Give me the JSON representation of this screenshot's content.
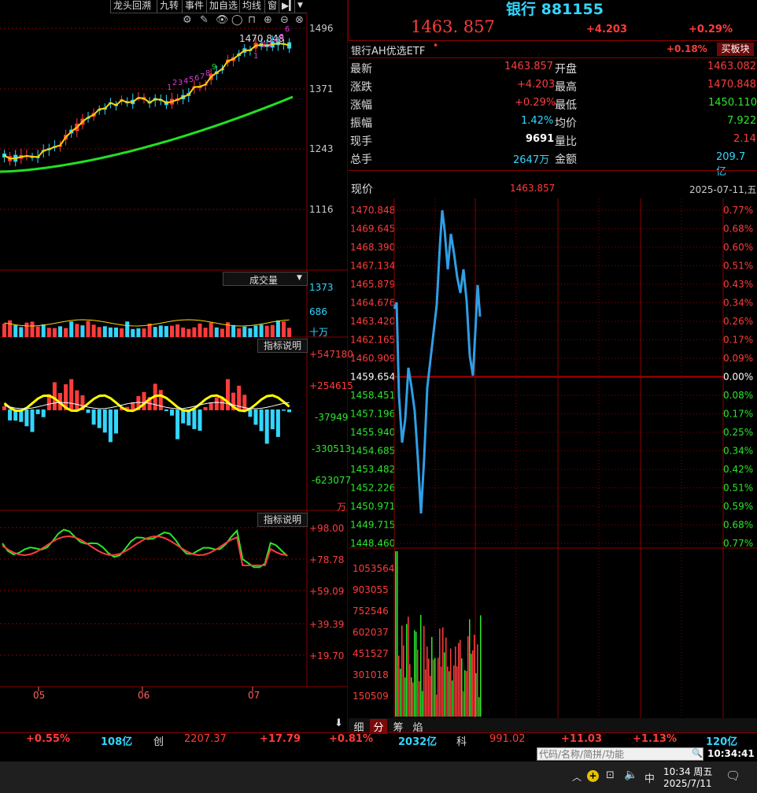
{
  "toolbar": {
    "buttons": [
      "龙头回溯",
      "九转",
      "事件",
      "加自选",
      "均线",
      "窗"
    ]
  },
  "kline": {
    "price_axis": [
      "1496",
      "1371",
      "1243",
      "1116"
    ],
    "high_label": "1470.848",
    "td_seq_low": [
      "1",
      "2",
      "3",
      "4",
      "5",
      "6",
      "7",
      "8",
      "9"
    ],
    "td_seq_recent": [
      "1",
      "2",
      "3",
      "4",
      "5",
      "6"
    ],
    "volume_title": "成交量",
    "volume_axis": [
      "1373",
      "686",
      "十万"
    ],
    "indicator_button": "指标说明",
    "macd_axis": [
      "+547180",
      "+254615",
      "-37949",
      "-330513",
      "-623077",
      "万"
    ],
    "kdj_axis": [
      "+98.00",
      "+78.78",
      "+59.09",
      "+39.39",
      "+19.70"
    ],
    "months": [
      "05",
      "06",
      "07"
    ]
  },
  "header": {
    "title": "银行 881155",
    "price": "1463. 857",
    "change": "+4.203",
    "change_pct": "+0.29%",
    "etf_name": "银行AH优选ETF",
    "etf_change": "+0.18%",
    "buy_block": "买板块"
  },
  "quote": {
    "rows": [
      {
        "l1": "最新",
        "v1": "1463.857",
        "l2": "开盘",
        "v2": "1463.082"
      },
      {
        "l1": "涨跌",
        "v1": "+4.203",
        "l2": "最高",
        "v2": "1470.848"
      },
      {
        "l1": "涨幅",
        "v1": "+0.29%",
        "l2": "最低",
        "v2": "1450.110"
      },
      {
        "l1": "振幅",
        "v1": "1.42%",
        "l2": "均价",
        "v2": "7.922"
      },
      {
        "l1": "现手",
        "v1": "9691",
        "l2": "量比",
        "v2": "2.14"
      },
      {
        "l1": "总手",
        "v1": "2647万",
        "l2": "金额",
        "v2": "209.7亿"
      }
    ]
  },
  "intraday": {
    "label_now": "现价",
    "now_value": "1463.857",
    "date": "2025-07-11,五",
    "price_ticks": [
      "1470.848",
      "1469.645",
      "1468.390",
      "1467.134",
      "1465.879",
      "1464.676",
      "1463.420",
      "1462.165",
      "1460.909",
      "1459.654",
      "1458.451",
      "1457.196",
      "1455.940",
      "1454.685",
      "1453.482",
      "1452.226",
      "1450.971",
      "1449.715",
      "1448.460"
    ],
    "pct_ticks": [
      "0.77%",
      "0.68%",
      "0.60%",
      "0.51%",
      "0.43%",
      "0.34%",
      "0.26%",
      "0.17%",
      "0.09%",
      "0.00%",
      "0.08%",
      "0.17%",
      "0.25%",
      "0.34%",
      "0.42%",
      "0.51%",
      "0.59%",
      "0.68%",
      "0.77%"
    ],
    "vol_ticks": [
      "1053564",
      "903055",
      "752546",
      "602037",
      "451527",
      "301018",
      "150509"
    ],
    "tabs": [
      "细",
      "分",
      "筹",
      "焰"
    ]
  },
  "status_bar": {
    "items": [
      "+0.55%",
      "108亿",
      "创",
      "2207.37",
      "+17.79",
      "+0.81%",
      "2032亿",
      "科",
      "991.02",
      "+11.03",
      "+1.13%",
      "120亿"
    ]
  },
  "search": {
    "placeholder": "代码/名称/简拼/功能"
  },
  "clock": "10:34:41",
  "taskbar": {
    "ime": "中",
    "time": "10:34 周五",
    "date": "2025/7/11"
  },
  "colors": {
    "up": "#ff3c3c",
    "down": "#2be62b",
    "price_line": "#2f9fe6",
    "ma_green": "#22e022",
    "grid": "#8b0000"
  }
}
